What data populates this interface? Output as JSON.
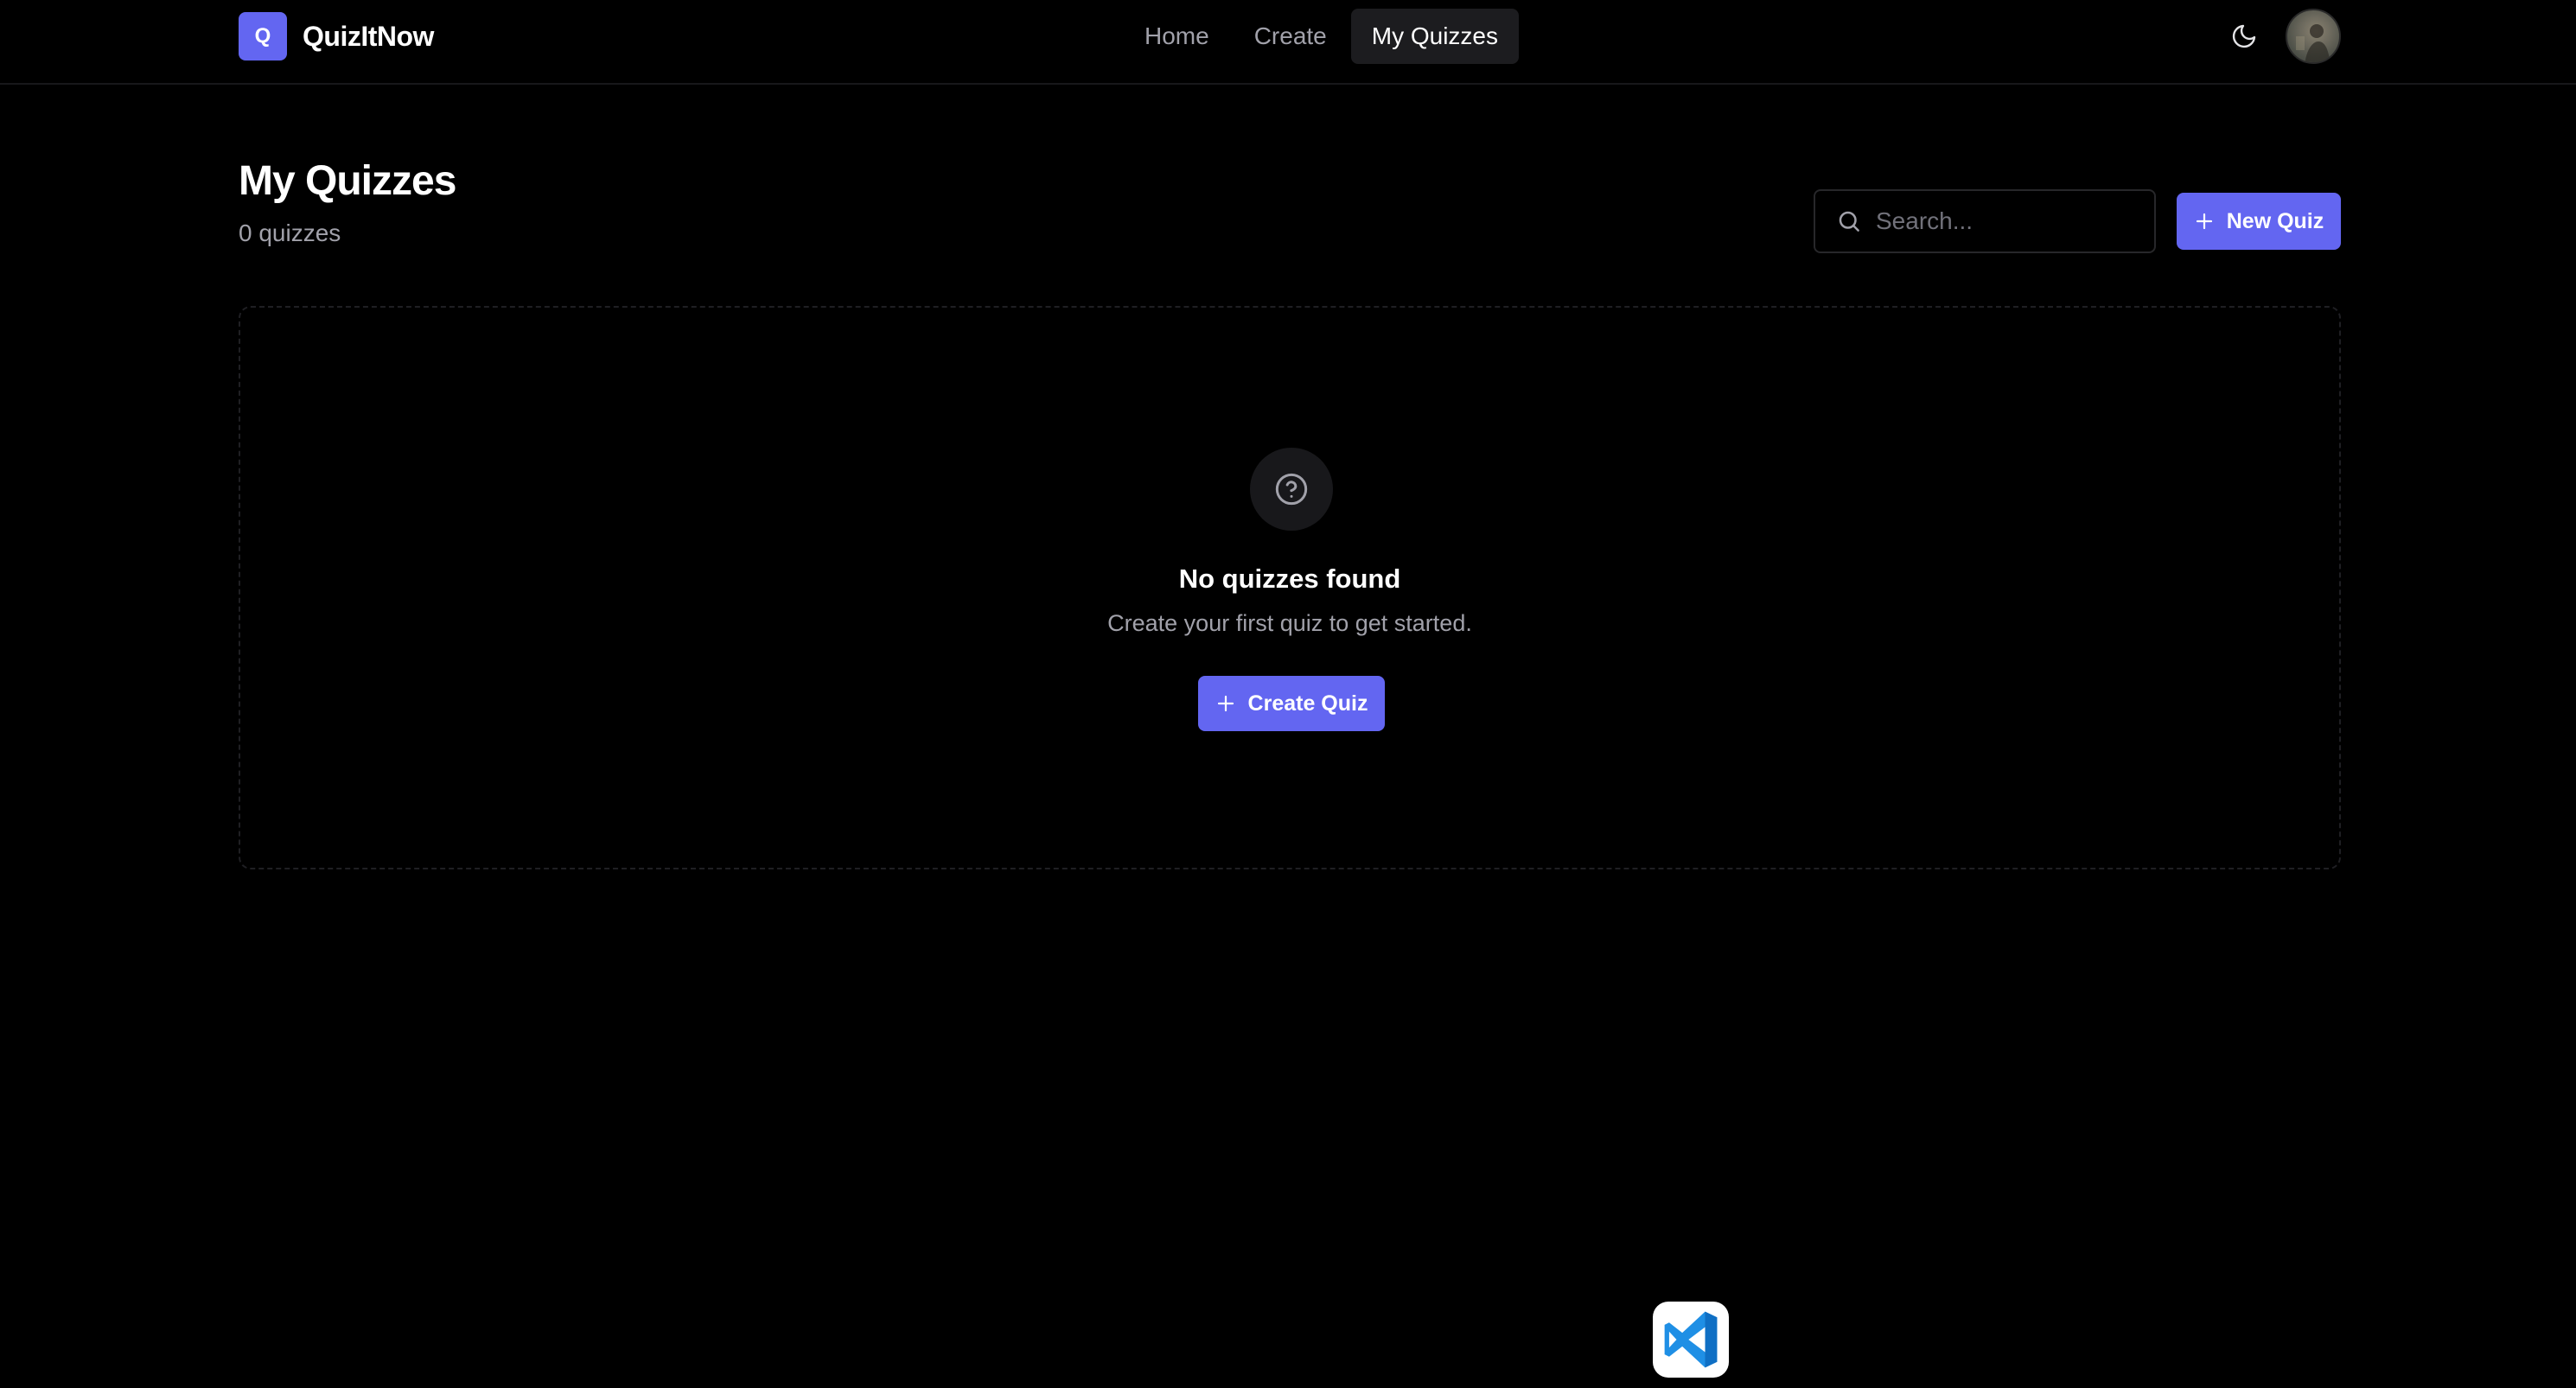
{
  "app": {
    "logo_letter": "Q",
    "name": "QuizItNow"
  },
  "nav": {
    "links": [
      {
        "label": "Home",
        "active": false
      },
      {
        "label": "Create",
        "active": false
      },
      {
        "label": "My Quizzes",
        "active": true
      }
    ],
    "theme_toggle_icon": "moon-icon",
    "avatar": "user-avatar"
  },
  "header": {
    "title": "My Quizzes",
    "count": "0 quizzes"
  },
  "search": {
    "placeholder": "Search...",
    "value": "",
    "icon": "search-icon"
  },
  "actions": {
    "new_quiz_label": "New Quiz",
    "new_quiz_icon": "plus-icon"
  },
  "empty_state": {
    "icon": "help-circle-icon",
    "title": "No quizzes found",
    "description": "Create your first quiz to get started.",
    "button_label": "Create Quiz",
    "button_icon": "plus-icon"
  },
  "dock": {
    "app_icon": "vscode-icon"
  },
  "colors": {
    "accent": "#6366f1",
    "background": "#000000",
    "muted_text": "#a1a1aa",
    "border": "#27272a"
  }
}
